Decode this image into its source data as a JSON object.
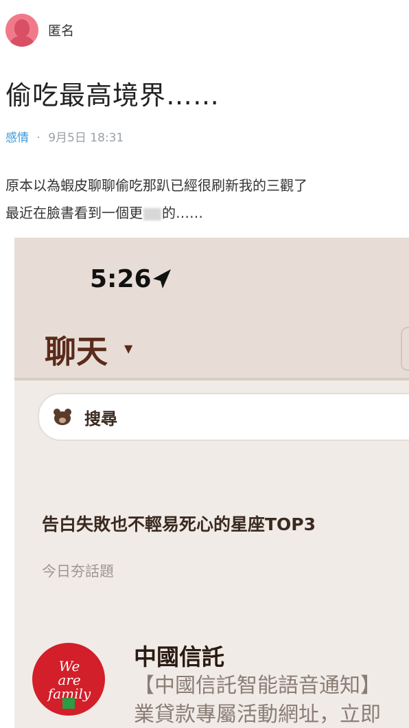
{
  "post": {
    "author": "匿名",
    "title": "偷吃最高境界……",
    "category": "感情",
    "separator": "·",
    "datetime": "9月5日 18:31",
    "content_line1": "原本以為蝦皮聊聊偷吃那趴已經很刷新我的三觀了",
    "content_line2_start": "最近在臉書看到一個更",
    "content_line2_end": "的……"
  },
  "screenshot": {
    "time": "5:26",
    "chat_title": "聊天",
    "search_placeholder": "搜尋",
    "topic_title": "告白失敗也不輕易死心的星座TOP3",
    "topic_subtitle": "今日夯話題",
    "logo_line1": "We",
    "logo_line2": "are",
    "logo_line3": "family",
    "sender_name": "中國信託",
    "preview_line1": "【中國信託智能語音通知】",
    "preview_line2": "業貸款專屬活動網址，立即"
  },
  "colors": {
    "category": "#3a9ad9",
    "avatar": "#f07a8a",
    "chat_title": "#5a2a1a",
    "logo": "#d21f2a"
  }
}
